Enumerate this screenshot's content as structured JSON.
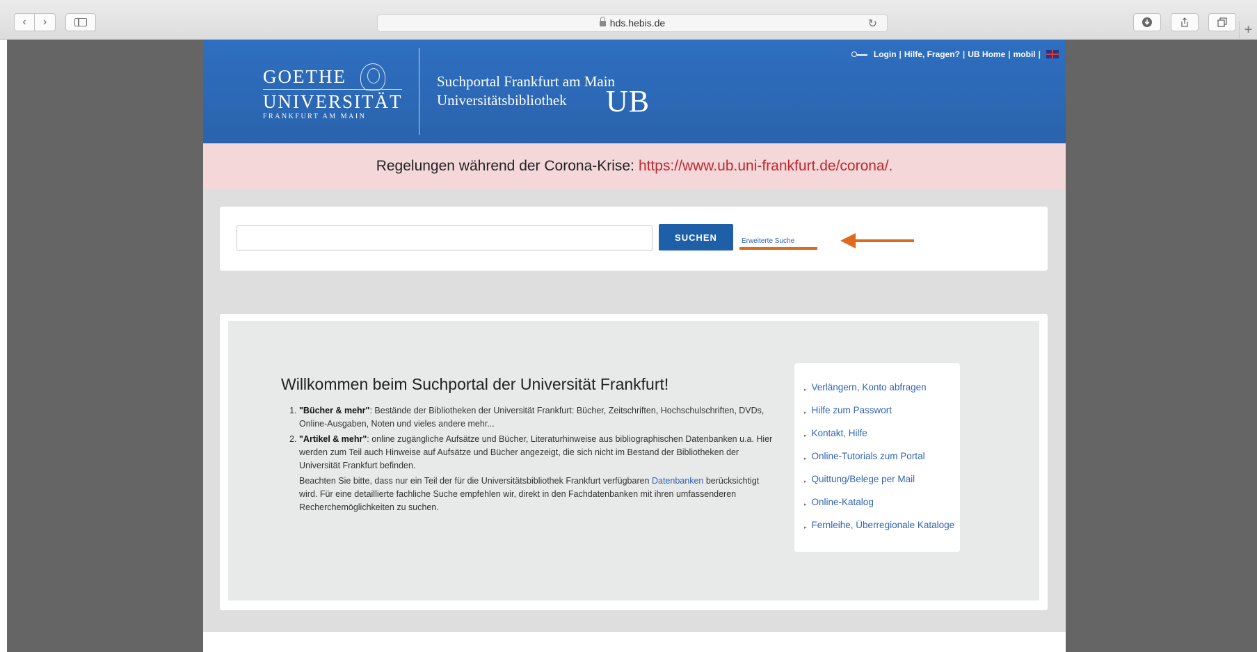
{
  "browser": {
    "url": "hds.hebis.de",
    "back_glyph": "‹",
    "forward_glyph": "›",
    "reload_glyph": "↻",
    "new_tab_glyph": "+"
  },
  "header": {
    "logo": {
      "line1": "GOETHE",
      "line2": "UNIVERSITÄT",
      "line3": "FRANKFURT AM MAIN"
    },
    "portal_line1": "Suchportal Frankfurt am Main",
    "portal_line2": "Universitätsbibliothek",
    "ub_mark": "UB",
    "nav": {
      "login": "Login",
      "help": "Hilfe, Fragen?",
      "ub_home": "UB Home",
      "mobil": "mobil",
      "sep": "|"
    }
  },
  "banner": {
    "text": "Regelungen während der Corona-Krise:",
    "link": "https://www.ub.uni-frankfurt.de/corona/.",
    "link_color": "#c0282d"
  },
  "search": {
    "value": "",
    "button_label": "SUCHEN",
    "advanced_label": "Erweiterte Suche",
    "annotation_color": "#de6a1d"
  },
  "welcome": {
    "title": "Willkommen beim Suchportal der Universität Frankfurt!",
    "item1_bold": "\"Bücher & mehr\"",
    "item1_text": ": Bestände der Bibliotheken der Universität Frankfurt: Bücher, Zeitschriften, Hochschulschriften, DVDs, Online-Ausgaben, Noten und vieles andere mehr...",
    "item2_bold": "\"Artikel & mehr\"",
    "item2_text": ": online zugängliche Aufsätze und Bücher, Literaturhinweise aus bibliographischen Datenbanken u.a. Hier werden zum Teil auch Hinweise auf Aufsätze und Bücher angezeigt, die sich nicht im Bestand der Bibliotheken der Universität Frankfurt befinden.",
    "note_before": "Beachten Sie bitte, dass nur ein Teil der für die Universitätsbibliothek Frankfurt verfügbaren ",
    "note_link": "Datenbanken",
    "note_after": " berücksichtigt wird. Für eine detaillierte fachliche Suche empfehlen wir, direkt in den Fachdatenbanken mit ihren umfassenderen Recherchemöglichkeiten zu suchen."
  },
  "quick_links": [
    "Verlängern, Konto abfragen",
    "Hilfe zum Passwort",
    "Kontakt, Hilfe",
    "Online-Tutorials zum Portal",
    "Quittung/Belege per Mail",
    "Online-Katalog",
    "Fernleihe, Überregionale Kataloge"
  ],
  "colors": {
    "header_blue": "#2a63ad",
    "link_blue": "#2f63b3",
    "button_blue": "#1f5fa8",
    "banner_bg": "#f3d7d9"
  }
}
